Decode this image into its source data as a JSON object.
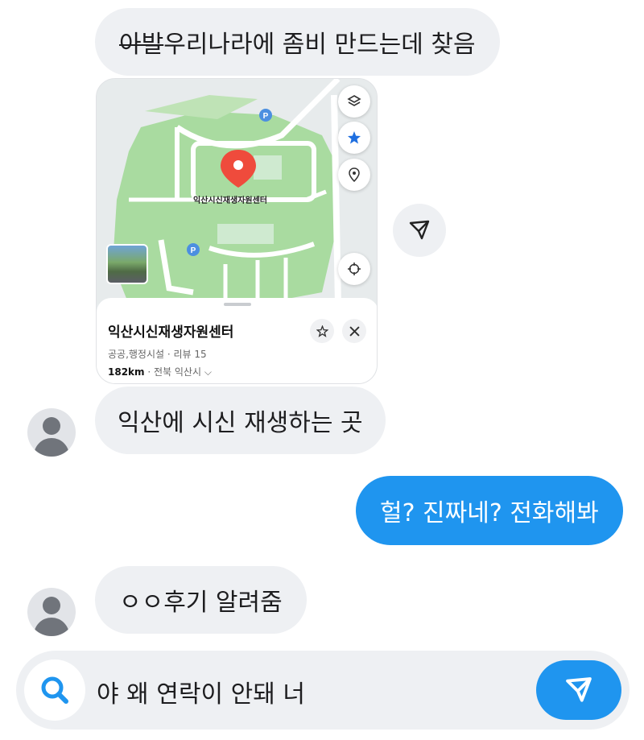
{
  "messages": {
    "m1": {
      "strike_text": "아발",
      "text": " 우리나라에 좀비 만드는데 찾음"
    },
    "m2": {
      "text": "익산에 시신 재생하는 곳"
    },
    "m3": {
      "text": "헐? 진짜네? 전화해봐"
    },
    "m4": {
      "text": "ㅇㅇ후기 알려줌"
    }
  },
  "map_card": {
    "pin_label": "익산시신재생자원센터",
    "place_name": "익산시신재생자원센터",
    "category": "공공,행정시설 · 리뷰 15",
    "distance": "182km",
    "location": " · 전북 익산시 ⌵",
    "buttons": [
      "layers-icon",
      "star-icon",
      "location-pin-icon",
      "target-icon"
    ]
  },
  "input": {
    "value": "야 왜 연락이 안돼 너"
  },
  "colors": {
    "accent": "#1f95ef",
    "incoming_bubble": "#eef0f3",
    "map_green": "#a9dba0",
    "map_pin": "#ef4b3c"
  }
}
